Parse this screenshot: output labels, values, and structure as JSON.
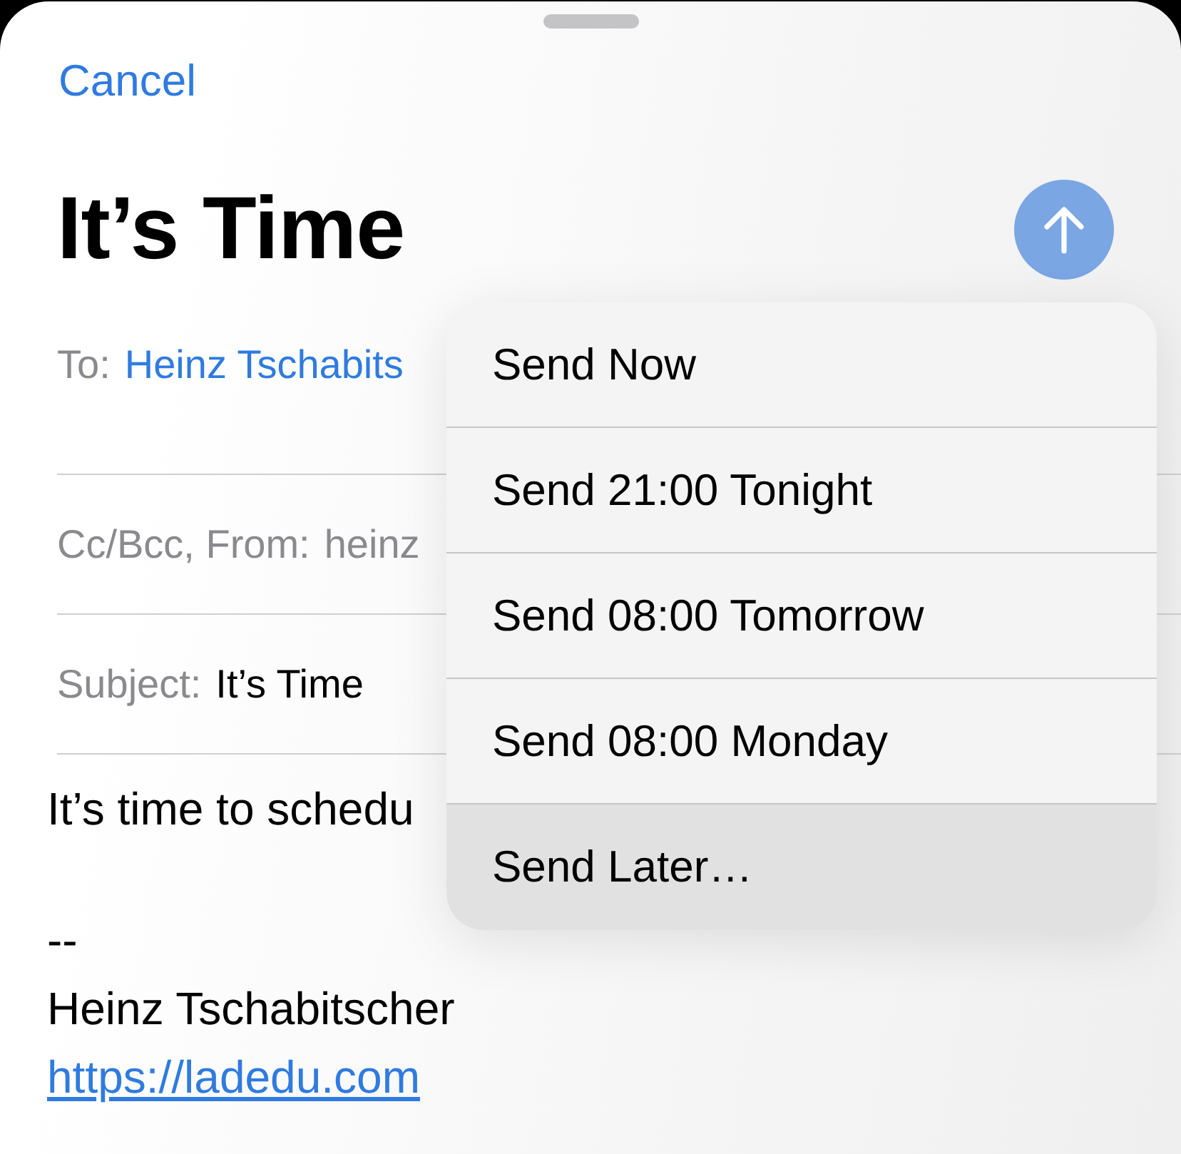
{
  "header": {
    "cancel": "Cancel",
    "title": "It’s Time"
  },
  "fields": [
    {
      "label": "To:",
      "value": "Heinz Tschabits",
      "kind": "recipient"
    },
    {
      "label": "Cc/Bcc, From:",
      "value": "heinz",
      "kind": "from"
    },
    {
      "label": "Subject:",
      "value": "It’s Time",
      "kind": "subject"
    }
  ],
  "body": {
    "paragraphs": [
      {
        "lines": [
          {
            "text": "It’s time to schedu",
            "kind": "text"
          }
        ]
      },
      {
        "lines": [
          {
            "text": "--",
            "kind": "text"
          },
          {
            "text": "Heinz Tschabitscher",
            "kind": "text"
          },
          {
            "text": "https://ladedu.com",
            "kind": "link"
          }
        ]
      }
    ]
  },
  "send_menu": {
    "items": [
      {
        "label": "Send Now",
        "selected": false
      },
      {
        "label": "Send 21:00 Tonight",
        "selected": false
      },
      {
        "label": "Send 08:00 Tomorrow",
        "selected": false
      },
      {
        "label": "Send 08:00 Monday",
        "selected": false
      },
      {
        "label": "Send Later…",
        "selected": true
      }
    ]
  }
}
